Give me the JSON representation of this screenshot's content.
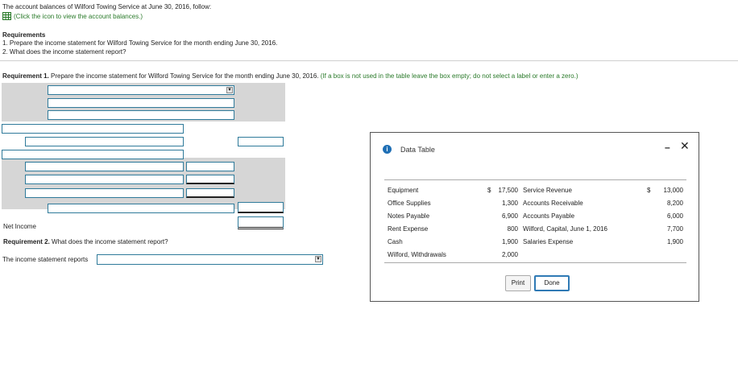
{
  "intro": {
    "line1": "The account balances of Wilford Towing Service at June 30, 2016, follow:",
    "link": "(Click the icon to view the account balances.)"
  },
  "requirements": {
    "heading": "Requirements",
    "item1": "1.  Prepare the income statement for Wilford Towing Service for the month ending June 30, 2016.",
    "item2": "2.  What does the income statement report?"
  },
  "req1": {
    "label": "Requirement 1.",
    "text": " Prepare the income statement for Wilford Towing Service for the month ending June 30, 2016.",
    "note": "(If a box is not used in the table leave the box empty; do not select a label or enter a zero.)"
  },
  "form": {
    "net_income_label": "Net Income"
  },
  "req2": {
    "label": "Requirement 2.",
    "text": " What does the income statement report?",
    "answer_label": "The income statement reports"
  },
  "modal": {
    "title": "Data Table",
    "rows": [
      {
        "left_name": "Equipment",
        "left_cur": "$",
        "left_val": "17,500",
        "right_name": "Service Revenue",
        "right_cur": "$",
        "right_val": "13,000"
      },
      {
        "left_name": "Office Supplies",
        "left_cur": "",
        "left_val": "1,300",
        "right_name": "Accounts Receivable",
        "right_cur": "",
        "right_val": "8,200"
      },
      {
        "left_name": "Notes Payable",
        "left_cur": "",
        "left_val": "6,900",
        "right_name": "Accounts Payable",
        "right_cur": "",
        "right_val": "6,000"
      },
      {
        "left_name": "Rent Expense",
        "left_cur": "",
        "left_val": "800",
        "right_name": "Wilford, Capital, June 1, 2016",
        "right_cur": "",
        "right_val": "7,700"
      },
      {
        "left_name": "Cash",
        "left_cur": "",
        "left_val": "1,900",
        "right_name": "Salaries Expense",
        "right_cur": "",
        "right_val": "1,900"
      },
      {
        "left_name": "Wilford, Withdrawals",
        "left_cur": "",
        "left_val": "2,000",
        "right_name": "",
        "right_cur": "",
        "right_val": ""
      }
    ],
    "print_label": "Print",
    "done_label": "Done"
  }
}
